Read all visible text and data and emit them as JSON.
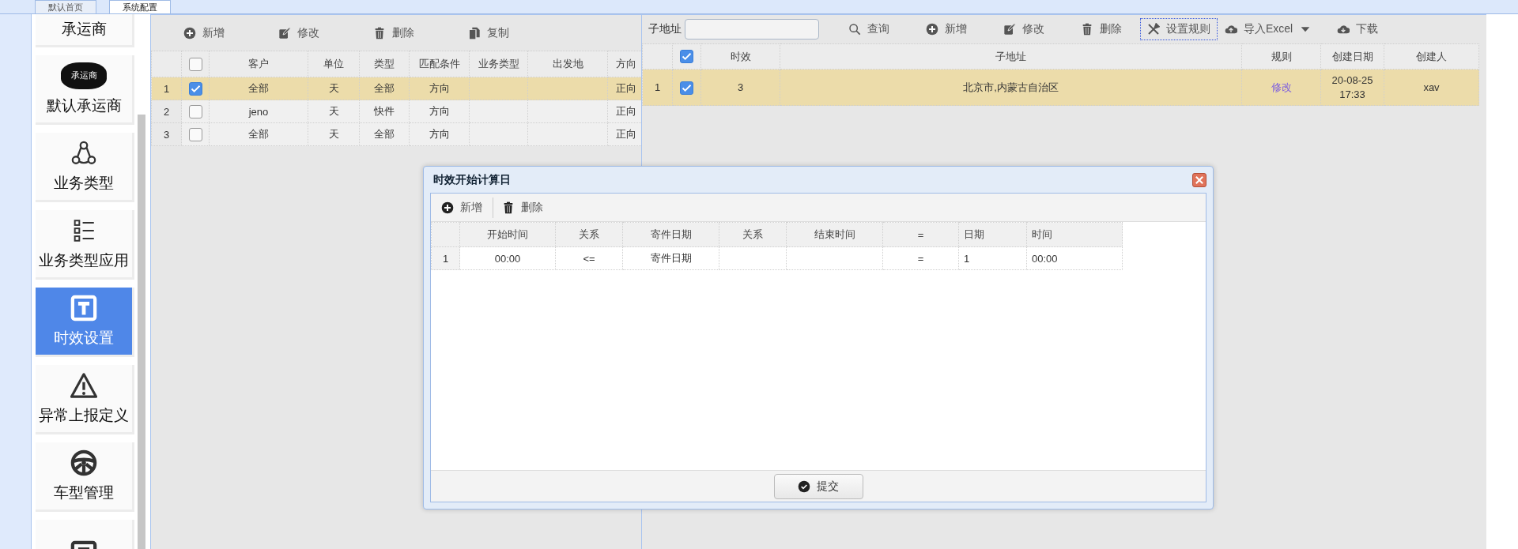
{
  "tabs": [
    {
      "label": "默认首页",
      "selected": false
    },
    {
      "label": "系统配置",
      "selected": true
    }
  ],
  "sidebar": {
    "items": [
      {
        "label": "承运商",
        "selected": false
      },
      {
        "label": "默认承运商",
        "badge": "承运商",
        "selected": false
      },
      {
        "label": "业务类型",
        "selected": false
      },
      {
        "label": "业务类型应用",
        "selected": false
      },
      {
        "label": "时效设置",
        "selected": true
      },
      {
        "label": "异常上报定义",
        "selected": false
      },
      {
        "label": "车型管理",
        "selected": false
      },
      {
        "selected": false
      }
    ]
  },
  "left_grid": {
    "toolbar": [
      "新增",
      "修改",
      "删除",
      "复制"
    ],
    "header_checked": false,
    "columns": [
      "客户",
      "单位",
      "类型",
      "匹配条件",
      "业务类型",
      "出发地",
      "方向"
    ],
    "rows": [
      {
        "number": "1",
        "selected": true,
        "cells": [
          "全部",
          "天",
          "全部",
          "方向",
          "",
          "",
          "正向"
        ]
      },
      {
        "number": "2",
        "selected": false,
        "cells": [
          "jeno",
          "天",
          "快件",
          "方向",
          "",
          "",
          "正向"
        ]
      },
      {
        "number": "3",
        "selected": false,
        "cells": [
          "全部",
          "天",
          "全部",
          "方向",
          "",
          "",
          "正向"
        ]
      }
    ]
  },
  "right_grid": {
    "search_label": "子地址",
    "toolbar": [
      {
        "label": "查询",
        "focused": false
      },
      {
        "label": "新增",
        "focused": false
      },
      {
        "label": "修改",
        "focused": false
      },
      {
        "label": "删除",
        "focused": false
      },
      {
        "label": "设置规则",
        "focused": true
      },
      {
        "label": "导入Excel",
        "focused": false
      },
      {
        "label": "下载",
        "focused": false
      }
    ],
    "header_checked": true,
    "columns": [
      "时效",
      "子地址",
      "规则",
      "创建日期",
      "创建人"
    ],
    "rows": [
      {
        "number": "1",
        "selected": true,
        "cells": [
          "3",
          "北京市,内蒙古自治区",
          "修改",
          "20-08-25 17:33",
          "xav"
        ]
      }
    ]
  },
  "dialog": {
    "title": "时效开始计算日",
    "toolbar": [
      "新增",
      "删除"
    ],
    "columns": [
      "开始时间",
      "关系",
      "寄件日期",
      "关系",
      "结束时间",
      "=",
      "日期",
      "时间"
    ],
    "rows": [
      {
        "number": "1",
        "cells": [
          "00:00",
          "<=",
          "寄件日期",
          "",
          "",
          "=",
          "1",
          "00:00"
        ]
      }
    ],
    "submit": "提交"
  }
}
